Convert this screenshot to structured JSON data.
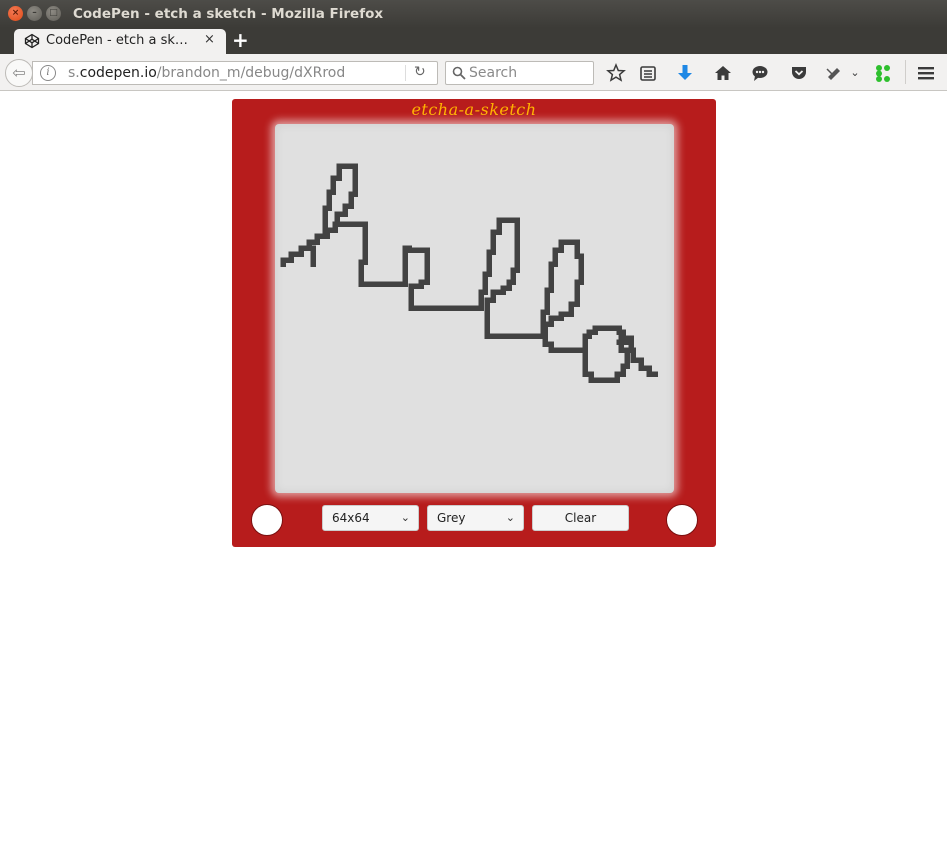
{
  "window": {
    "title": "CodePen - etch a sketch - Mozilla Firefox",
    "close_glyph": "×",
    "min_glyph": "–",
    "max_glyph": "□"
  },
  "tabs": [
    {
      "title": "CodePen - etch a sk…",
      "icon": "codepen-icon",
      "close_glyph": "×",
      "active": true
    }
  ],
  "new_tab_glyph": "+",
  "navbar": {
    "back_glyph": "⇦",
    "url_prefix": "s.",
    "url_domain": "codepen.io",
    "url_path": "/brandon_m/debug/dXRrod",
    "reload_glyph": "↻",
    "search_placeholder": "Search",
    "toolbar_icons": [
      "star-icon",
      "reader-list-icon",
      "download-icon",
      "home-icon",
      "chat-icon",
      "pocket-icon",
      "extension-icon",
      "apps-icon",
      "menu-icon"
    ]
  },
  "app": {
    "title": "etcha-a-sketch",
    "grid_size": "64x64",
    "color_mode": "Grey",
    "clear_label": "Clear",
    "chevron_glyph": "⌄",
    "ink_color": "#424242",
    "body_color": "#b71c1c",
    "title_color": "#ffb300",
    "screen_color": "#e0e0e0"
  }
}
